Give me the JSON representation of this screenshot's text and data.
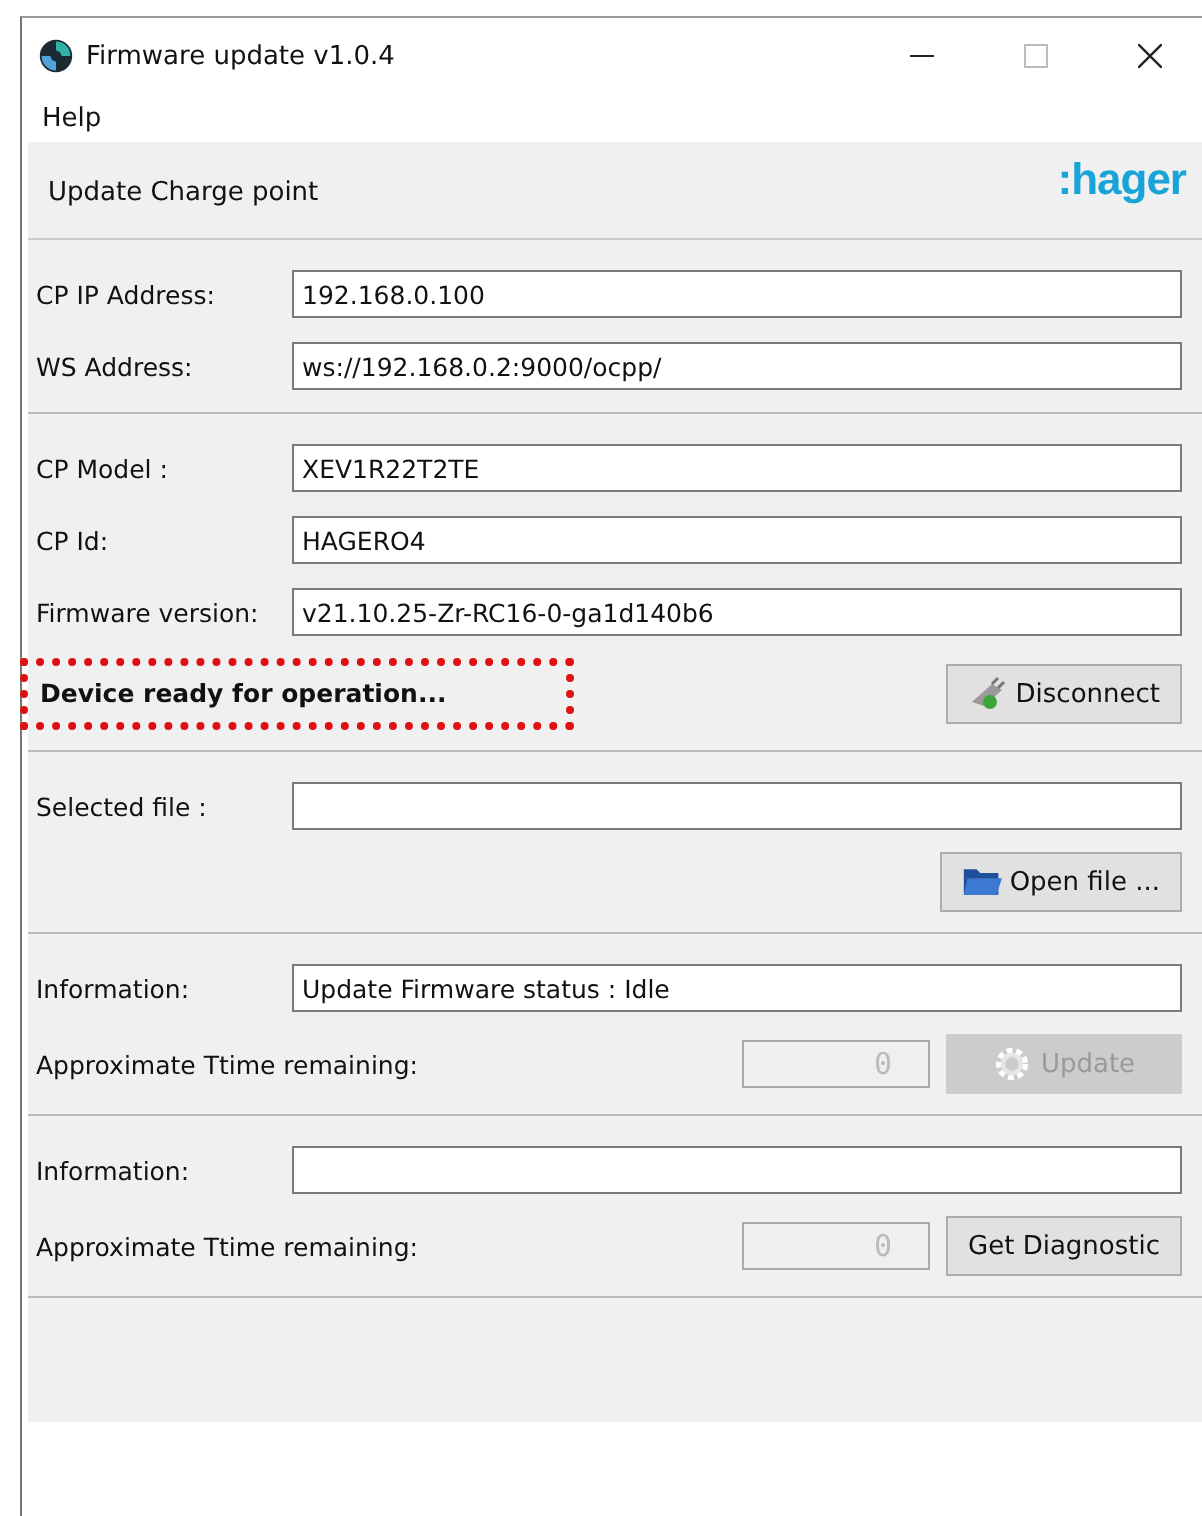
{
  "window": {
    "title": "Firmware update v1.0.4"
  },
  "menu": [
    "Help"
  ],
  "logo": ":hager",
  "group_title": "Update Charge point",
  "connection": [
    {
      "label": "CP IP Address:",
      "value": "192.168.0.100"
    },
    {
      "label": "WS Address:",
      "value": "ws://192.168.0.2:9000/ocpp/"
    }
  ],
  "device": {
    "fields": [
      {
        "label": "CP Model :",
        "value": "XEV1R22T2TE"
      },
      {
        "label": "CP Id:",
        "value": "HAGERO4"
      },
      {
        "label": "Firmware version:",
        "value": "v21.10.25-Zr-RC16-0-ga1d140b6"
      }
    ],
    "status": "Device ready for operation...",
    "button": {
      "label": "Disconnect",
      "disabled": false
    }
  },
  "file": {
    "label": "Selected file :",
    "button": {
      "label": "Open file ...",
      "disabled": false
    }
  },
  "update": {
    "info_label": "Information:",
    "info_value": "Update Firmware status : Idle",
    "time_label": "Approximate Ttime remaining:",
    "counter": "0",
    "button": {
      "label": "Update",
      "disabled": true
    }
  },
  "diagnostic": {
    "info_label": "Information:",
    "time_label": "Approximate Ttime remaining:",
    "counter": "0",
    "button": {
      "label": "Get Diagnostic",
      "disabled": false
    }
  }
}
